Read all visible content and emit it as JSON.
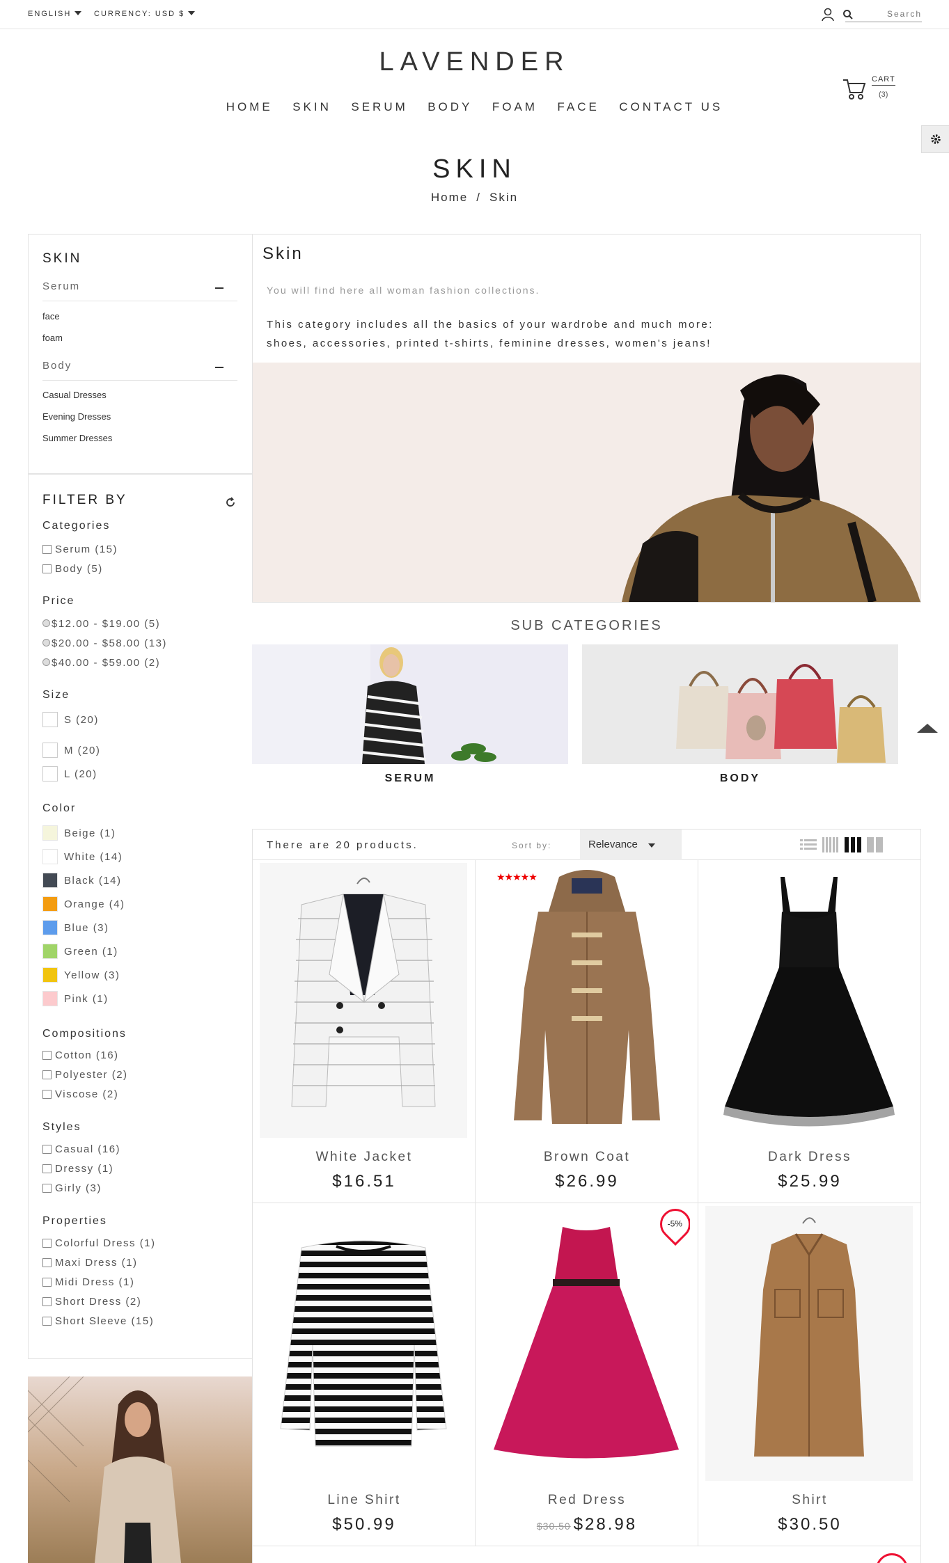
{
  "topbar": {
    "language": "ENGLISH",
    "currency": "CURRENCY: USD $",
    "search_placeholder": "Search"
  },
  "brand": "LAVENDER",
  "nav": [
    "HOME",
    "SKIN",
    "SERUM",
    "BODY",
    "FOAM",
    "FACE",
    "CONTACT US"
  ],
  "cart": {
    "label": "CART",
    "count": "(3)"
  },
  "page": {
    "title": "SKIN",
    "breadcrumb": [
      "Home",
      "/",
      "Skin"
    ]
  },
  "categories": {
    "title": "SKIN",
    "groups": [
      {
        "name": "Serum",
        "items": [
          "face",
          "foam"
        ]
      },
      {
        "name": "Body",
        "items": [
          "Casual Dresses",
          "Evening Dresses",
          "Summer Dresses"
        ]
      }
    ]
  },
  "filters": {
    "title": "FILTER BY",
    "categories": {
      "label": "Categories",
      "items": [
        "Serum (15)",
        "Body (5)"
      ]
    },
    "price": {
      "label": "Price",
      "items": [
        "$12.00 - $19.00 (5)",
        "$20.00 - $58.00 (13)",
        "$40.00 - $59.00 (2)"
      ]
    },
    "size": {
      "label": "Size",
      "items": [
        "S (20)",
        "M (20)",
        "L (20)"
      ]
    },
    "color": {
      "label": "Color",
      "items": [
        {
          "name": "Beige (1)",
          "hex": "#f5f5dc"
        },
        {
          "name": "White (14)",
          "hex": "#ffffff"
        },
        {
          "name": "Black (14)",
          "hex": "#434a54"
        },
        {
          "name": "Orange (4)",
          "hex": "#f39c11"
        },
        {
          "name": "Blue (3)",
          "hex": "#5d9cec"
        },
        {
          "name": "Green (1)",
          "hex": "#a0d468"
        },
        {
          "name": "Yellow (3)",
          "hex": "#f1c40f"
        },
        {
          "name": "Pink (1)",
          "hex": "#fccacd"
        }
      ]
    },
    "compositions": {
      "label": "Compositions",
      "items": [
        "Cotton (16)",
        "Polyester (2)",
        "Viscose (2)"
      ]
    },
    "styles": {
      "label": "Styles",
      "items": [
        "Casual (16)",
        "Dressy (1)",
        "Girly (3)"
      ]
    },
    "properties": {
      "label": "Properties",
      "items": [
        "Colorful Dress (1)",
        "Maxi Dress (1)",
        "Midi Dress (1)",
        "Short Dress (2)",
        "Short Sleeve (15)"
      ]
    }
  },
  "category_info": {
    "heading": "Skin",
    "subtitle": "You will find here all woman fashion collections.",
    "description_1": "This category includes all the basics of your wardrobe and much more:",
    "description_2": "shoes, accessories, printed t-shirts, feminine dresses, women's jeans!"
  },
  "subcategories": {
    "title": "SUB CATEGORIES",
    "items": [
      "SERUM",
      "BODY"
    ]
  },
  "listing": {
    "count_text": "There are 20 products.",
    "sort_label": "Sort by:",
    "sort_value": "Relevance"
  },
  "products": [
    {
      "name": "White Jacket",
      "price": "$16.51"
    },
    {
      "name": "Brown Coat",
      "price": "$26.99",
      "rating": 5
    },
    {
      "name": "Dark Dress",
      "price": "$25.99"
    },
    {
      "name": "Line Shirt",
      "price": "$50.99"
    },
    {
      "name": "Red Dress",
      "price": "$28.98",
      "old_price": "$30.50",
      "discount": "-5%"
    },
    {
      "name": "Shirt",
      "price": "$30.50"
    }
  ],
  "colors": {
    "accent": "#e11133",
    "border": "#e3e3e3",
    "text": "#333333"
  }
}
